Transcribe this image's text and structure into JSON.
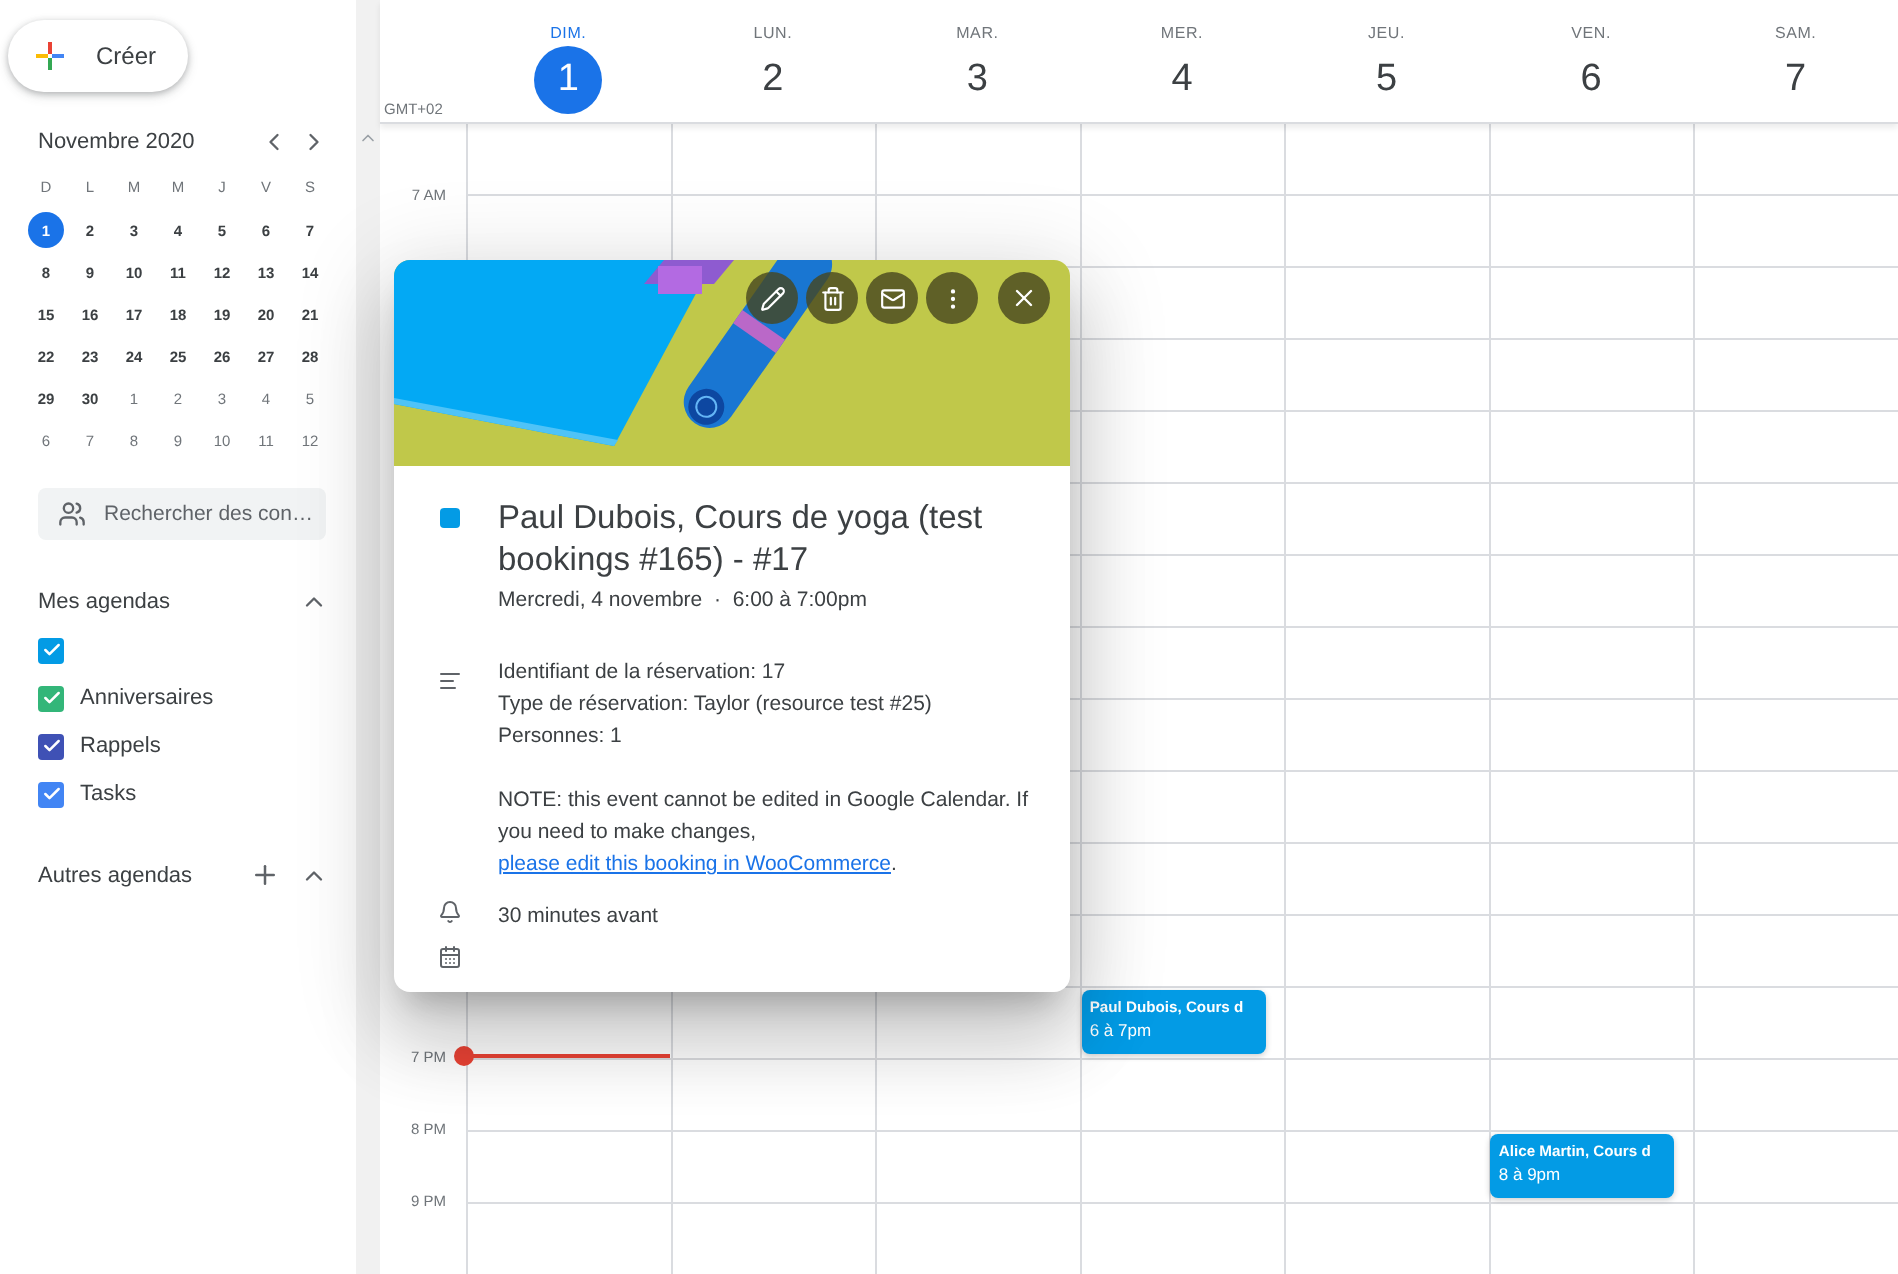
{
  "create_button": {
    "label": "Créer"
  },
  "mini_calendar": {
    "month": "Novembre 2020",
    "weekdays": [
      "D",
      "L",
      "M",
      "M",
      "J",
      "V",
      "S"
    ],
    "weeks": [
      [
        {
          "day": "1",
          "selected": true,
          "outside": false
        },
        {
          "day": "2",
          "selected": false,
          "outside": false
        },
        {
          "day": "3",
          "selected": false,
          "outside": false
        },
        {
          "day": "4",
          "selected": false,
          "outside": false
        },
        {
          "day": "5",
          "selected": false,
          "outside": false
        },
        {
          "day": "6",
          "selected": false,
          "outside": false
        },
        {
          "day": "7",
          "selected": false,
          "outside": false
        }
      ],
      [
        {
          "day": "8",
          "selected": false,
          "outside": false
        },
        {
          "day": "9",
          "selected": false,
          "outside": false
        },
        {
          "day": "10",
          "selected": false,
          "outside": false
        },
        {
          "day": "11",
          "selected": false,
          "outside": false
        },
        {
          "day": "12",
          "selected": false,
          "outside": false
        },
        {
          "day": "13",
          "selected": false,
          "outside": false
        },
        {
          "day": "14",
          "selected": false,
          "outside": false
        }
      ],
      [
        {
          "day": "15",
          "selected": false,
          "outside": false
        },
        {
          "day": "16",
          "selected": false,
          "outside": false
        },
        {
          "day": "17",
          "selected": false,
          "outside": false
        },
        {
          "day": "18",
          "selected": false,
          "outside": false
        },
        {
          "day": "19",
          "selected": false,
          "outside": false
        },
        {
          "day": "20",
          "selected": false,
          "outside": false
        },
        {
          "day": "21",
          "selected": false,
          "outside": false
        }
      ],
      [
        {
          "day": "22",
          "selected": false,
          "outside": false
        },
        {
          "day": "23",
          "selected": false,
          "outside": false
        },
        {
          "day": "24",
          "selected": false,
          "outside": false
        },
        {
          "day": "25",
          "selected": false,
          "outside": false
        },
        {
          "day": "26",
          "selected": false,
          "outside": false
        },
        {
          "day": "27",
          "selected": false,
          "outside": false
        },
        {
          "day": "28",
          "selected": false,
          "outside": false
        }
      ],
      [
        {
          "day": "29",
          "selected": false,
          "outside": false
        },
        {
          "day": "30",
          "selected": false,
          "outside": false
        },
        {
          "day": "1",
          "selected": false,
          "outside": true
        },
        {
          "day": "2",
          "selected": false,
          "outside": true
        },
        {
          "day": "3",
          "selected": false,
          "outside": true
        },
        {
          "day": "4",
          "selected": false,
          "outside": true
        },
        {
          "day": "5",
          "selected": false,
          "outside": true
        }
      ],
      [
        {
          "day": "6",
          "selected": false,
          "outside": true
        },
        {
          "day": "7",
          "selected": false,
          "outside": true
        },
        {
          "day": "8",
          "selected": false,
          "outside": true
        },
        {
          "day": "9",
          "selected": false,
          "outside": true
        },
        {
          "day": "10",
          "selected": false,
          "outside": true
        },
        {
          "day": "11",
          "selected": false,
          "outside": true
        },
        {
          "day": "12",
          "selected": false,
          "outside": true
        }
      ]
    ]
  },
  "search": {
    "placeholder": "Rechercher des con…"
  },
  "my_calendars": {
    "title": "Mes agendas",
    "expanded": true,
    "items": [
      {
        "checked": true,
        "color": "#039be5"
      },
      {
        "label": "Anniversaires",
        "checked": true,
        "color": "#33b679"
      },
      {
        "label": "Rappels",
        "checked": true,
        "color": "#3f51b5"
      },
      {
        "label": "Tasks",
        "checked": true,
        "color": "#4285f4"
      }
    ]
  },
  "other_calendars": {
    "title": "Autres agendas",
    "expanded": true
  },
  "timezone": "GMT+02",
  "days": [
    {
      "name": "DIM.",
      "date": "1",
      "selected": true
    },
    {
      "name": "LUN.",
      "date": "2",
      "selected": false
    },
    {
      "name": "MAR.",
      "date": "3",
      "selected": false
    },
    {
      "name": "MER.",
      "date": "4",
      "selected": false
    },
    {
      "name": "JEU.",
      "date": "5",
      "selected": false
    },
    {
      "name": "VEN.",
      "date": "6",
      "selected": false
    },
    {
      "name": "SAM.",
      "date": "7",
      "selected": false
    }
  ],
  "morning_slots": [
    {
      "label": "7 AM"
    }
  ],
  "evening_slots": [
    {
      "cells": [
        {},
        {},
        {},
        {
          "event": {
            "title": "Paul Dubois, Cours d",
            "time": "6 à 7pm"
          }
        },
        {},
        {},
        {}
      ]
    },
    {
      "label": "7 PM",
      "now": true
    },
    {
      "label": "8 PM",
      "cells": [
        {},
        {},
        {},
        {},
        {},
        {
          "event": {
            "title": "Alice Martin, Cours d",
            "time": "8 à 9pm"
          }
        },
        {}
      ]
    },
    {
      "label": "9 PM"
    }
  ],
  "popup": {
    "title": "Paul Dubois, Cours de yoga (test bookings #165) - #17",
    "date": "Mercredi, 4 novembre",
    "separator": "·",
    "time": "6:00 à 7:00pm",
    "description_lines": [
      "Identifiant de la réservation: 17",
      "Type de réservation: Taylor (resource test #25)",
      "Personnes: 1"
    ],
    "note": {
      "text": "NOTE: this event cannot be edited in Google Calendar. If you need to make changes, ",
      "link": "please edit this booking in WooCommerce",
      "after": "."
    },
    "reminder": "30 minutes avant"
  }
}
